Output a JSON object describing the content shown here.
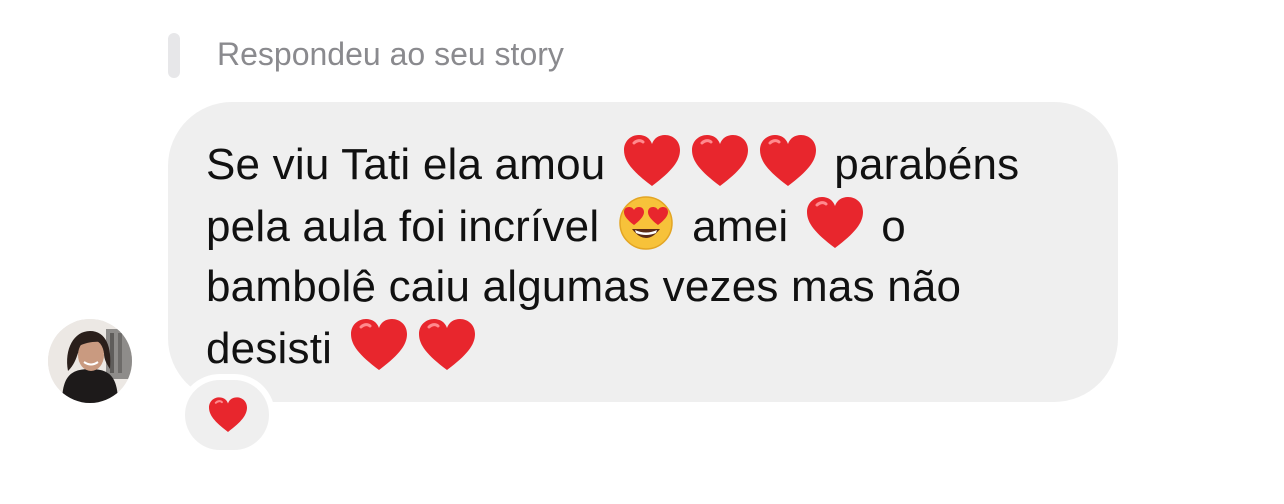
{
  "reply": {
    "label": "Respondeu ao seu story"
  },
  "message": {
    "line1_a": "Se viu Tati ela amou",
    "line1_b": "parabéns",
    "line2_a": "pela aula foi incrível",
    "line2_b": "amei",
    "line2_c": "o",
    "line3": "bambolê caiu algumas vezes mas não",
    "line4": "desisti"
  },
  "icons": {
    "heart": "red-heart-icon",
    "heart_eyes": "smiling-face-with-heart-eyes-icon",
    "avatar": "profile-avatar"
  },
  "reaction": {
    "emoji": "red-heart-icon"
  },
  "colors": {
    "bubble": "#efefef",
    "reply_bar": "#e7e7e9",
    "reply_text": "#8a8a8e",
    "heart": "#e8262d"
  }
}
